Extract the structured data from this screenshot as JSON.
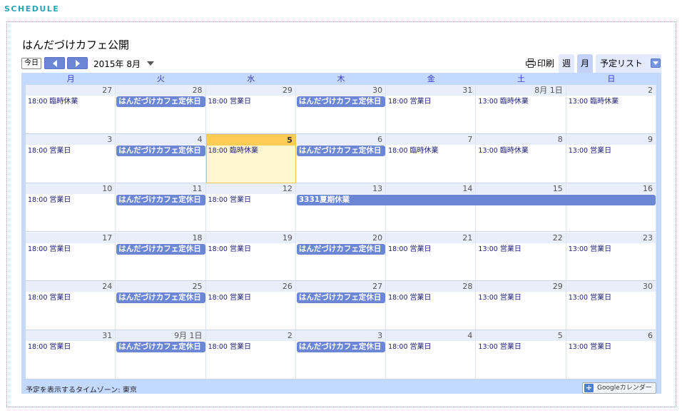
{
  "section_title": "SCHEDULE",
  "calendar_title": "はんだづけカフェ公開",
  "toolbar": {
    "today_label": "今日",
    "month_label": "2015年 8月",
    "print_label": "印刷",
    "tabs": {
      "week": "週",
      "month": "月",
      "agenda": "予定リスト"
    }
  },
  "weekdays": [
    "月",
    "火",
    "水",
    "木",
    "金",
    "土",
    "日"
  ],
  "colors": {
    "accent": "#6b86d4",
    "header_bg": "#c3d9ff",
    "today": "#ffcc55"
  },
  "weeks": [
    {
      "dates": [
        "27",
        "28",
        "29",
        "30",
        "31",
        "8月 1日",
        "2"
      ],
      "events": [
        {
          "col": 0,
          "time": "18:00",
          "title": "臨時休業",
          "chip": false
        },
        {
          "col": 1,
          "time": "",
          "title": "はんだづけカフェ定休日",
          "chip": true
        },
        {
          "col": 2,
          "time": "18:00",
          "title": "営業日",
          "chip": false
        },
        {
          "col": 3,
          "time": "",
          "title": "はんだづけカフェ定休日",
          "chip": true
        },
        {
          "col": 4,
          "time": "18:00",
          "title": "営業日",
          "chip": false
        },
        {
          "col": 5,
          "time": "13:00",
          "title": "臨時休業",
          "chip": false
        },
        {
          "col": 6,
          "time": "13:00",
          "title": "臨時休業",
          "chip": false
        }
      ]
    },
    {
      "dates": [
        "3",
        "4",
        "5",
        "6",
        "7",
        "8",
        "9"
      ],
      "events": [
        {
          "col": 0,
          "time": "18:00",
          "title": "営業日",
          "chip": false
        },
        {
          "col": 1,
          "time": "",
          "title": "はんだづけカフェ定休日",
          "chip": true
        },
        {
          "col": 2,
          "time": "18:00",
          "title": "臨時休業",
          "chip": false
        },
        {
          "col": 3,
          "time": "",
          "title": "はんだづけカフェ定休日",
          "chip": true
        },
        {
          "col": 4,
          "time": "18:00",
          "title": "臨時休業",
          "chip": false
        },
        {
          "col": 5,
          "time": "13:00",
          "title": "臨時休業",
          "chip": false
        },
        {
          "col": 6,
          "time": "13:00",
          "title": "営業日",
          "chip": false
        }
      ]
    },
    {
      "dates": [
        "10",
        "11",
        "12",
        "13",
        "14",
        "15",
        "16"
      ],
      "events": [
        {
          "col": 0,
          "time": "18:00",
          "title": "営業日",
          "chip": false
        },
        {
          "col": 1,
          "time": "",
          "title": "はんだづけカフェ定休日",
          "chip": true
        },
        {
          "col": 2,
          "time": "18:00",
          "title": "営業日",
          "chip": false
        },
        {
          "col": 3,
          "span": 4,
          "time": "",
          "title": "3331夏期休業",
          "chip": true
        }
      ]
    },
    {
      "dates": [
        "17",
        "18",
        "19",
        "20",
        "21",
        "22",
        "23"
      ],
      "events": [
        {
          "col": 0,
          "time": "18:00",
          "title": "営業日",
          "chip": false
        },
        {
          "col": 1,
          "time": "",
          "title": "はんだづけカフェ定休日",
          "chip": true
        },
        {
          "col": 2,
          "time": "18:00",
          "title": "営業日",
          "chip": false
        },
        {
          "col": 3,
          "time": "",
          "title": "はんだづけカフェ定休日",
          "chip": true
        },
        {
          "col": 4,
          "time": "18:00",
          "title": "営業日",
          "chip": false
        },
        {
          "col": 5,
          "time": "13:00",
          "title": "営業日",
          "chip": false
        },
        {
          "col": 6,
          "time": "13:00",
          "title": "営業日",
          "chip": false
        }
      ]
    },
    {
      "dates": [
        "24",
        "25",
        "26",
        "27",
        "28",
        "29",
        "30"
      ],
      "events": [
        {
          "col": 0,
          "time": "18:00",
          "title": "営業日",
          "chip": false
        },
        {
          "col": 1,
          "time": "",
          "title": "はんだづけカフェ定休日",
          "chip": true
        },
        {
          "col": 2,
          "time": "18:00",
          "title": "営業日",
          "chip": false
        },
        {
          "col": 3,
          "time": "",
          "title": "はんだづけカフェ定休日",
          "chip": true
        },
        {
          "col": 4,
          "time": "18:00",
          "title": "営業日",
          "chip": false
        },
        {
          "col": 5,
          "time": "13:00",
          "title": "営業日",
          "chip": false
        },
        {
          "col": 6,
          "time": "13:00",
          "title": "営業日",
          "chip": false
        }
      ]
    },
    {
      "dates": [
        "31",
        "9月 1日",
        "2",
        "3",
        "4",
        "5",
        "6"
      ],
      "events": [
        {
          "col": 0,
          "time": "18:00",
          "title": "営業日",
          "chip": false
        },
        {
          "col": 1,
          "time": "",
          "title": "はんだづけカフェ定休日",
          "chip": true
        },
        {
          "col": 2,
          "time": "18:00",
          "title": "営業日",
          "chip": false
        },
        {
          "col": 3,
          "time": "",
          "title": "はんだづけカフェ定休日",
          "chip": true
        },
        {
          "col": 4,
          "time": "18:00",
          "title": "営業日",
          "chip": false
        },
        {
          "col": 5,
          "time": "13:00",
          "title": "営業日",
          "chip": false
        },
        {
          "col": 6,
          "time": "13:00",
          "title": "営業日",
          "chip": false
        }
      ]
    }
  ],
  "today": {
    "week": 1,
    "col": 2
  },
  "timezone_note": "予定を表示するタイムゾーン: 東京",
  "gcal_badge": "Googleカレンダー"
}
